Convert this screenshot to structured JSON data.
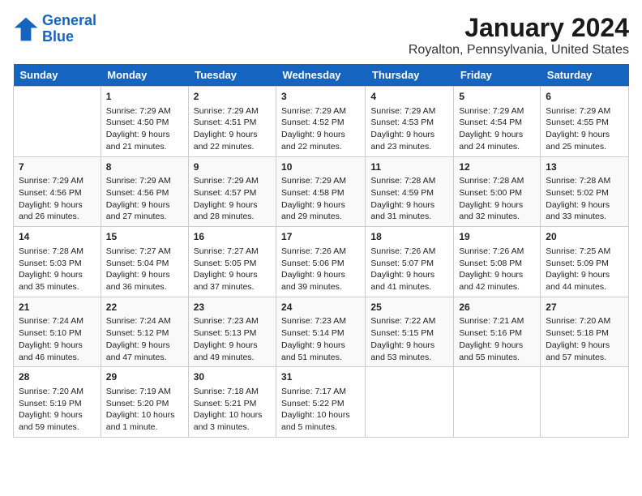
{
  "logo": {
    "line1": "General",
    "line2": "Blue"
  },
  "title": "January 2024",
  "subtitle": "Royalton, Pennsylvania, United States",
  "header_days": [
    "Sunday",
    "Monday",
    "Tuesday",
    "Wednesday",
    "Thursday",
    "Friday",
    "Saturday"
  ],
  "weeks": [
    [
      {
        "num": "",
        "info": ""
      },
      {
        "num": "1",
        "info": "Sunrise: 7:29 AM\nSunset: 4:50 PM\nDaylight: 9 hours\nand 21 minutes."
      },
      {
        "num": "2",
        "info": "Sunrise: 7:29 AM\nSunset: 4:51 PM\nDaylight: 9 hours\nand 22 minutes."
      },
      {
        "num": "3",
        "info": "Sunrise: 7:29 AM\nSunset: 4:52 PM\nDaylight: 9 hours\nand 22 minutes."
      },
      {
        "num": "4",
        "info": "Sunrise: 7:29 AM\nSunset: 4:53 PM\nDaylight: 9 hours\nand 23 minutes."
      },
      {
        "num": "5",
        "info": "Sunrise: 7:29 AM\nSunset: 4:54 PM\nDaylight: 9 hours\nand 24 minutes."
      },
      {
        "num": "6",
        "info": "Sunrise: 7:29 AM\nSunset: 4:55 PM\nDaylight: 9 hours\nand 25 minutes."
      }
    ],
    [
      {
        "num": "7",
        "info": "Sunrise: 7:29 AM\nSunset: 4:56 PM\nDaylight: 9 hours\nand 26 minutes."
      },
      {
        "num": "8",
        "info": "Sunrise: 7:29 AM\nSunset: 4:56 PM\nDaylight: 9 hours\nand 27 minutes."
      },
      {
        "num": "9",
        "info": "Sunrise: 7:29 AM\nSunset: 4:57 PM\nDaylight: 9 hours\nand 28 minutes."
      },
      {
        "num": "10",
        "info": "Sunrise: 7:29 AM\nSunset: 4:58 PM\nDaylight: 9 hours\nand 29 minutes."
      },
      {
        "num": "11",
        "info": "Sunrise: 7:28 AM\nSunset: 4:59 PM\nDaylight: 9 hours\nand 31 minutes."
      },
      {
        "num": "12",
        "info": "Sunrise: 7:28 AM\nSunset: 5:00 PM\nDaylight: 9 hours\nand 32 minutes."
      },
      {
        "num": "13",
        "info": "Sunrise: 7:28 AM\nSunset: 5:02 PM\nDaylight: 9 hours\nand 33 minutes."
      }
    ],
    [
      {
        "num": "14",
        "info": "Sunrise: 7:28 AM\nSunset: 5:03 PM\nDaylight: 9 hours\nand 35 minutes."
      },
      {
        "num": "15",
        "info": "Sunrise: 7:27 AM\nSunset: 5:04 PM\nDaylight: 9 hours\nand 36 minutes."
      },
      {
        "num": "16",
        "info": "Sunrise: 7:27 AM\nSunset: 5:05 PM\nDaylight: 9 hours\nand 37 minutes."
      },
      {
        "num": "17",
        "info": "Sunrise: 7:26 AM\nSunset: 5:06 PM\nDaylight: 9 hours\nand 39 minutes."
      },
      {
        "num": "18",
        "info": "Sunrise: 7:26 AM\nSunset: 5:07 PM\nDaylight: 9 hours\nand 41 minutes."
      },
      {
        "num": "19",
        "info": "Sunrise: 7:26 AM\nSunset: 5:08 PM\nDaylight: 9 hours\nand 42 minutes."
      },
      {
        "num": "20",
        "info": "Sunrise: 7:25 AM\nSunset: 5:09 PM\nDaylight: 9 hours\nand 44 minutes."
      }
    ],
    [
      {
        "num": "21",
        "info": "Sunrise: 7:24 AM\nSunset: 5:10 PM\nDaylight: 9 hours\nand 46 minutes."
      },
      {
        "num": "22",
        "info": "Sunrise: 7:24 AM\nSunset: 5:12 PM\nDaylight: 9 hours\nand 47 minutes."
      },
      {
        "num": "23",
        "info": "Sunrise: 7:23 AM\nSunset: 5:13 PM\nDaylight: 9 hours\nand 49 minutes."
      },
      {
        "num": "24",
        "info": "Sunrise: 7:23 AM\nSunset: 5:14 PM\nDaylight: 9 hours\nand 51 minutes."
      },
      {
        "num": "25",
        "info": "Sunrise: 7:22 AM\nSunset: 5:15 PM\nDaylight: 9 hours\nand 53 minutes."
      },
      {
        "num": "26",
        "info": "Sunrise: 7:21 AM\nSunset: 5:16 PM\nDaylight: 9 hours\nand 55 minutes."
      },
      {
        "num": "27",
        "info": "Sunrise: 7:20 AM\nSunset: 5:18 PM\nDaylight: 9 hours\nand 57 minutes."
      }
    ],
    [
      {
        "num": "28",
        "info": "Sunrise: 7:20 AM\nSunset: 5:19 PM\nDaylight: 9 hours\nand 59 minutes."
      },
      {
        "num": "29",
        "info": "Sunrise: 7:19 AM\nSunset: 5:20 PM\nDaylight: 10 hours\nand 1 minute."
      },
      {
        "num": "30",
        "info": "Sunrise: 7:18 AM\nSunset: 5:21 PM\nDaylight: 10 hours\nand 3 minutes."
      },
      {
        "num": "31",
        "info": "Sunrise: 7:17 AM\nSunset: 5:22 PM\nDaylight: 10 hours\nand 5 minutes."
      },
      {
        "num": "",
        "info": ""
      },
      {
        "num": "",
        "info": ""
      },
      {
        "num": "",
        "info": ""
      }
    ]
  ]
}
